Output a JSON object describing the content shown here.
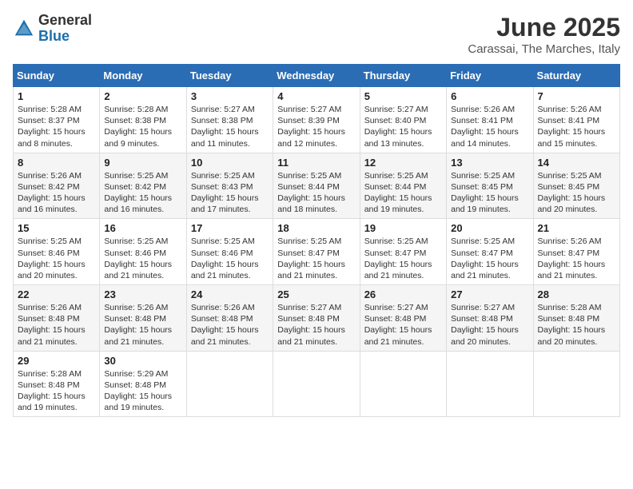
{
  "logo": {
    "general": "General",
    "blue": "Blue"
  },
  "header": {
    "month": "June 2025",
    "location": "Carassai, The Marches, Italy"
  },
  "weekdays": [
    "Sunday",
    "Monday",
    "Tuesday",
    "Wednesday",
    "Thursday",
    "Friday",
    "Saturday"
  ],
  "weeks": [
    [
      {
        "day": "1",
        "sunrise": "5:28 AM",
        "sunset": "8:37 PM",
        "daylight": "15 hours and 8 minutes."
      },
      {
        "day": "2",
        "sunrise": "5:28 AM",
        "sunset": "8:38 PM",
        "daylight": "15 hours and 9 minutes."
      },
      {
        "day": "3",
        "sunrise": "5:27 AM",
        "sunset": "8:38 PM",
        "daylight": "15 hours and 11 minutes."
      },
      {
        "day": "4",
        "sunrise": "5:27 AM",
        "sunset": "8:39 PM",
        "daylight": "15 hours and 12 minutes."
      },
      {
        "day": "5",
        "sunrise": "5:27 AM",
        "sunset": "8:40 PM",
        "daylight": "15 hours and 13 minutes."
      },
      {
        "day": "6",
        "sunrise": "5:26 AM",
        "sunset": "8:41 PM",
        "daylight": "15 hours and 14 minutes."
      },
      {
        "day": "7",
        "sunrise": "5:26 AM",
        "sunset": "8:41 PM",
        "daylight": "15 hours and 15 minutes."
      }
    ],
    [
      {
        "day": "8",
        "sunrise": "5:26 AM",
        "sunset": "8:42 PM",
        "daylight": "15 hours and 16 minutes."
      },
      {
        "day": "9",
        "sunrise": "5:25 AM",
        "sunset": "8:42 PM",
        "daylight": "15 hours and 16 minutes."
      },
      {
        "day": "10",
        "sunrise": "5:25 AM",
        "sunset": "8:43 PM",
        "daylight": "15 hours and 17 minutes."
      },
      {
        "day": "11",
        "sunrise": "5:25 AM",
        "sunset": "8:44 PM",
        "daylight": "15 hours and 18 minutes."
      },
      {
        "day": "12",
        "sunrise": "5:25 AM",
        "sunset": "8:44 PM",
        "daylight": "15 hours and 19 minutes."
      },
      {
        "day": "13",
        "sunrise": "5:25 AM",
        "sunset": "8:45 PM",
        "daylight": "15 hours and 19 minutes."
      },
      {
        "day": "14",
        "sunrise": "5:25 AM",
        "sunset": "8:45 PM",
        "daylight": "15 hours and 20 minutes."
      }
    ],
    [
      {
        "day": "15",
        "sunrise": "5:25 AM",
        "sunset": "8:46 PM",
        "daylight": "15 hours and 20 minutes."
      },
      {
        "day": "16",
        "sunrise": "5:25 AM",
        "sunset": "8:46 PM",
        "daylight": "15 hours and 21 minutes."
      },
      {
        "day": "17",
        "sunrise": "5:25 AM",
        "sunset": "8:46 PM",
        "daylight": "15 hours and 21 minutes."
      },
      {
        "day": "18",
        "sunrise": "5:25 AM",
        "sunset": "8:47 PM",
        "daylight": "15 hours and 21 minutes."
      },
      {
        "day": "19",
        "sunrise": "5:25 AM",
        "sunset": "8:47 PM",
        "daylight": "15 hours and 21 minutes."
      },
      {
        "day": "20",
        "sunrise": "5:25 AM",
        "sunset": "8:47 PM",
        "daylight": "15 hours and 21 minutes."
      },
      {
        "day": "21",
        "sunrise": "5:26 AM",
        "sunset": "8:47 PM",
        "daylight": "15 hours and 21 minutes."
      }
    ],
    [
      {
        "day": "22",
        "sunrise": "5:26 AM",
        "sunset": "8:48 PM",
        "daylight": "15 hours and 21 minutes."
      },
      {
        "day": "23",
        "sunrise": "5:26 AM",
        "sunset": "8:48 PM",
        "daylight": "15 hours and 21 minutes."
      },
      {
        "day": "24",
        "sunrise": "5:26 AM",
        "sunset": "8:48 PM",
        "daylight": "15 hours and 21 minutes."
      },
      {
        "day": "25",
        "sunrise": "5:27 AM",
        "sunset": "8:48 PM",
        "daylight": "15 hours and 21 minutes."
      },
      {
        "day": "26",
        "sunrise": "5:27 AM",
        "sunset": "8:48 PM",
        "daylight": "15 hours and 21 minutes."
      },
      {
        "day": "27",
        "sunrise": "5:27 AM",
        "sunset": "8:48 PM",
        "daylight": "15 hours and 20 minutes."
      },
      {
        "day": "28",
        "sunrise": "5:28 AM",
        "sunset": "8:48 PM",
        "daylight": "15 hours and 20 minutes."
      }
    ],
    [
      {
        "day": "29",
        "sunrise": "5:28 AM",
        "sunset": "8:48 PM",
        "daylight": "15 hours and 19 minutes."
      },
      {
        "day": "30",
        "sunrise": "5:29 AM",
        "sunset": "8:48 PM",
        "daylight": "15 hours and 19 minutes."
      },
      null,
      null,
      null,
      null,
      null
    ]
  ],
  "labels": {
    "sunrise": "Sunrise: ",
    "sunset": "Sunset: ",
    "daylight": "Daylight: "
  }
}
